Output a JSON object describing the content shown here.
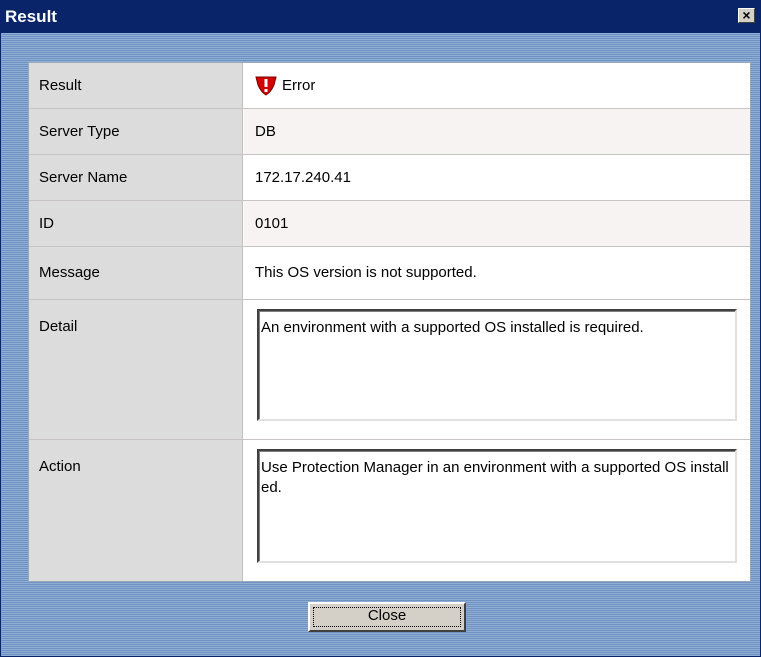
{
  "window": {
    "title": "Result",
    "close_glyph": "×"
  },
  "rows": [
    {
      "label": "Result",
      "value": "Error",
      "icon": "error-shield-icon"
    },
    {
      "label": "Server Type",
      "value": "DB"
    },
    {
      "label": "Server Name",
      "value": "172.17.240.41"
    },
    {
      "label": "ID",
      "value": "0101"
    },
    {
      "label": "Message",
      "value": "This OS version is not supported."
    },
    {
      "label": "Detail",
      "value": "An environment with a supported OS installed is required."
    },
    {
      "label": "Action",
      "value": "Use Protection Manager in an environment with a supported OS installed."
    }
  ],
  "buttons": {
    "close": "Close"
  },
  "colors": {
    "titlebar": "#0a246a",
    "error_red": "#d40000",
    "background": "#7b9cc8"
  }
}
